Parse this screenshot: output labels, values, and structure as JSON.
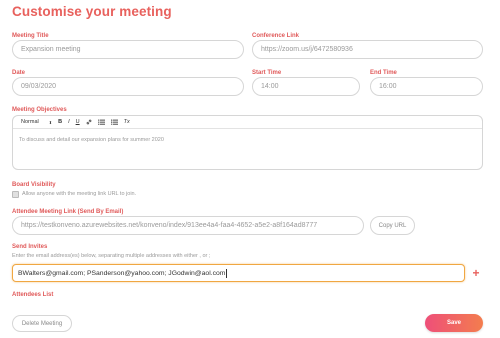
{
  "page": {
    "title": "Customise your meeting"
  },
  "meeting_title": {
    "label": "Meeting Title",
    "value": "Expansion meeting"
  },
  "conference_link": {
    "label": "Conference Link",
    "value": "https://zoom.us/j/6472580936"
  },
  "date": {
    "label": "Date",
    "value": "09/03/2020"
  },
  "start_time": {
    "label": "Start Time",
    "value": "14:00"
  },
  "end_time": {
    "label": "End Time",
    "value": "16:00"
  },
  "objectives": {
    "label": "Meeting Objectives",
    "toolbar": {
      "style_select": "Normal",
      "style_arrow": "⬍",
      "bold": "B",
      "italic": "I",
      "underline": "U",
      "link": "🔗",
      "ordered_list": "☰",
      "bullet_list": "☷",
      "clear_format": "Tx"
    },
    "text": "To discuss and detail our expansion plans for summer 2020"
  },
  "board_visibility": {
    "label": "Board Visibility",
    "checkbox_label": "Allow anyone with the meeting link URL to join."
  },
  "attendee_link": {
    "label": "Attendee Meeting Link (Send By Email)",
    "value": "https://testkonveno.azurewebsites.net/konveno/index/913ee4a4-faa4-4652-a5e2-a8f164ad8777",
    "copy_button": "Copy URL"
  },
  "send_invites": {
    "label": "Send Invites",
    "hint": "Enter the email address(es) below, separating multiple addresses with either , or ;",
    "value": "BWalters@gmail.com; PSanderson@yahoo.com; JGodwin@aol.com",
    "add_icon": "+"
  },
  "attendees_list": {
    "label": "Attendees List"
  },
  "buttons": {
    "delete": "Delete Meeting",
    "save": "Save"
  }
}
